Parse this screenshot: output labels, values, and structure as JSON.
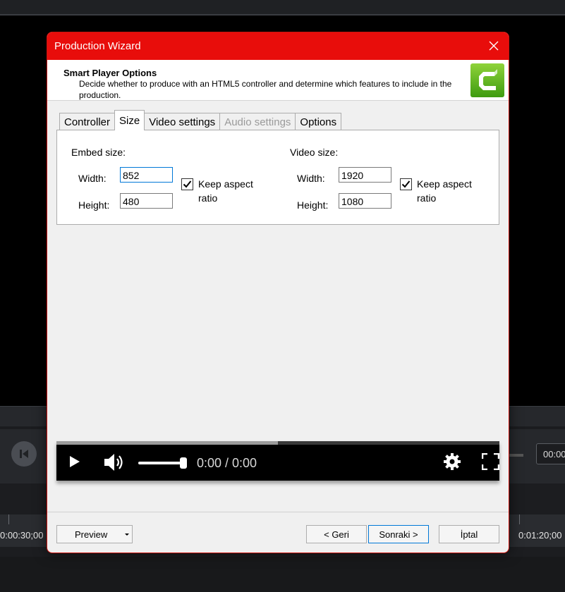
{
  "background": {
    "transport_time": "00:00",
    "ruler_left_time": "0:00:30;00",
    "ruler_right_time": "0:01:20;00"
  },
  "dialog": {
    "title": "Production Wizard",
    "header": {
      "title": "Smart Player Options",
      "description": "Decide whether to produce with an HTML5 controller and determine which features to include in the production."
    },
    "tabs": [
      {
        "label": "Controller",
        "state": "normal"
      },
      {
        "label": "Size",
        "state": "active"
      },
      {
        "label": "Video settings",
        "state": "normal"
      },
      {
        "label": "Audio settings",
        "state": "disabled"
      },
      {
        "label": "Options",
        "state": "normal"
      }
    ],
    "embed": {
      "label": "Embed size:",
      "width_label": "Width:",
      "width_value": "852",
      "height_label": "Height:",
      "height_value": "480",
      "keep_aspect_label": "Keep aspect ratio",
      "keep_aspect_checked": true
    },
    "video": {
      "label": "Video size:",
      "width_label": "Width:",
      "width_value": "1920",
      "height_label": "Height:",
      "height_value": "1080",
      "keep_aspect_label": "Keep aspect ratio",
      "keep_aspect_checked": true
    },
    "player": {
      "time": "0:00 / 0:00",
      "progress_fraction": 0.5,
      "volume_fraction": 1.0
    },
    "buttons": {
      "preview": "Preview",
      "back": "< Geri",
      "next": "Sonraki >",
      "cancel": "İptal"
    }
  },
  "colors": {
    "titlebar": "#e80d0b",
    "logo_green": "#5cb82a",
    "focus_blue": "#0078d7"
  }
}
